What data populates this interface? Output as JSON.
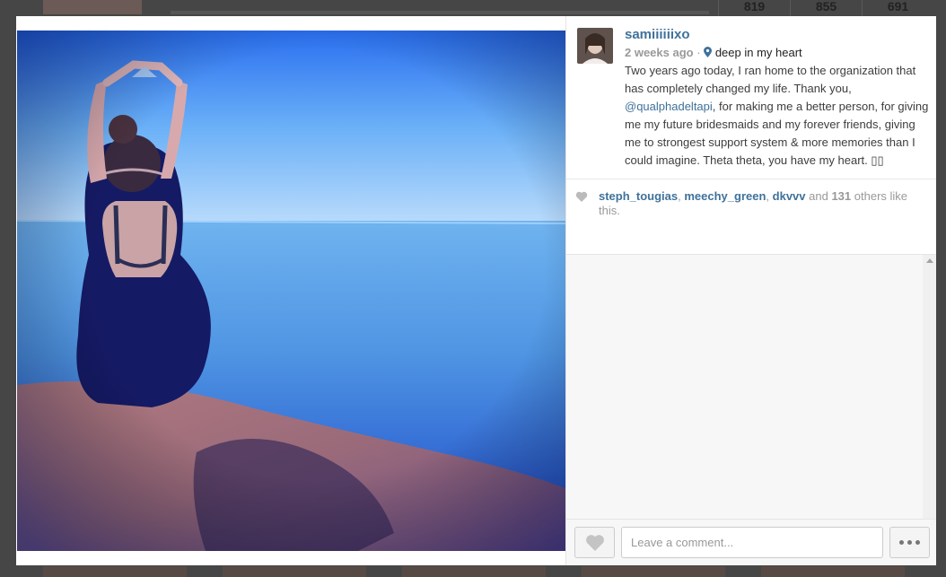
{
  "background": {
    "stats": [
      "819",
      "855",
      "691"
    ]
  },
  "post": {
    "username": "samiiiiiixo",
    "timestamp": "2 weeks ago",
    "separator": "·",
    "location": "deep in my heart",
    "caption_before_mention": "Two years ago today, I ran home to the organization that has completely changed my life. Thank you, ",
    "mention": "@qualphadeltapi",
    "caption_after_mention": ", for making me a better person, for giving me my future bridesmaids and my forever friends, giving me to strongest support system & more memories than I could imagine. Theta theta, you have my heart. ▯▯"
  },
  "likes": {
    "likers": [
      "steph_tougias",
      "meechy_green",
      "dkvvv"
    ],
    "sep1": ", ",
    "sep2": ", ",
    "and_text": " and ",
    "count": "131",
    "suffix": " others like this."
  },
  "comment_box": {
    "placeholder": "Leave a comment..."
  },
  "icons": {
    "location": "map-pin-icon",
    "likes": "heart-icon",
    "like_button": "heart-icon",
    "more": "ellipsis-icon"
  },
  "colors": {
    "username": "#3f729b",
    "muted": "#999999",
    "overlay": "#464646"
  }
}
